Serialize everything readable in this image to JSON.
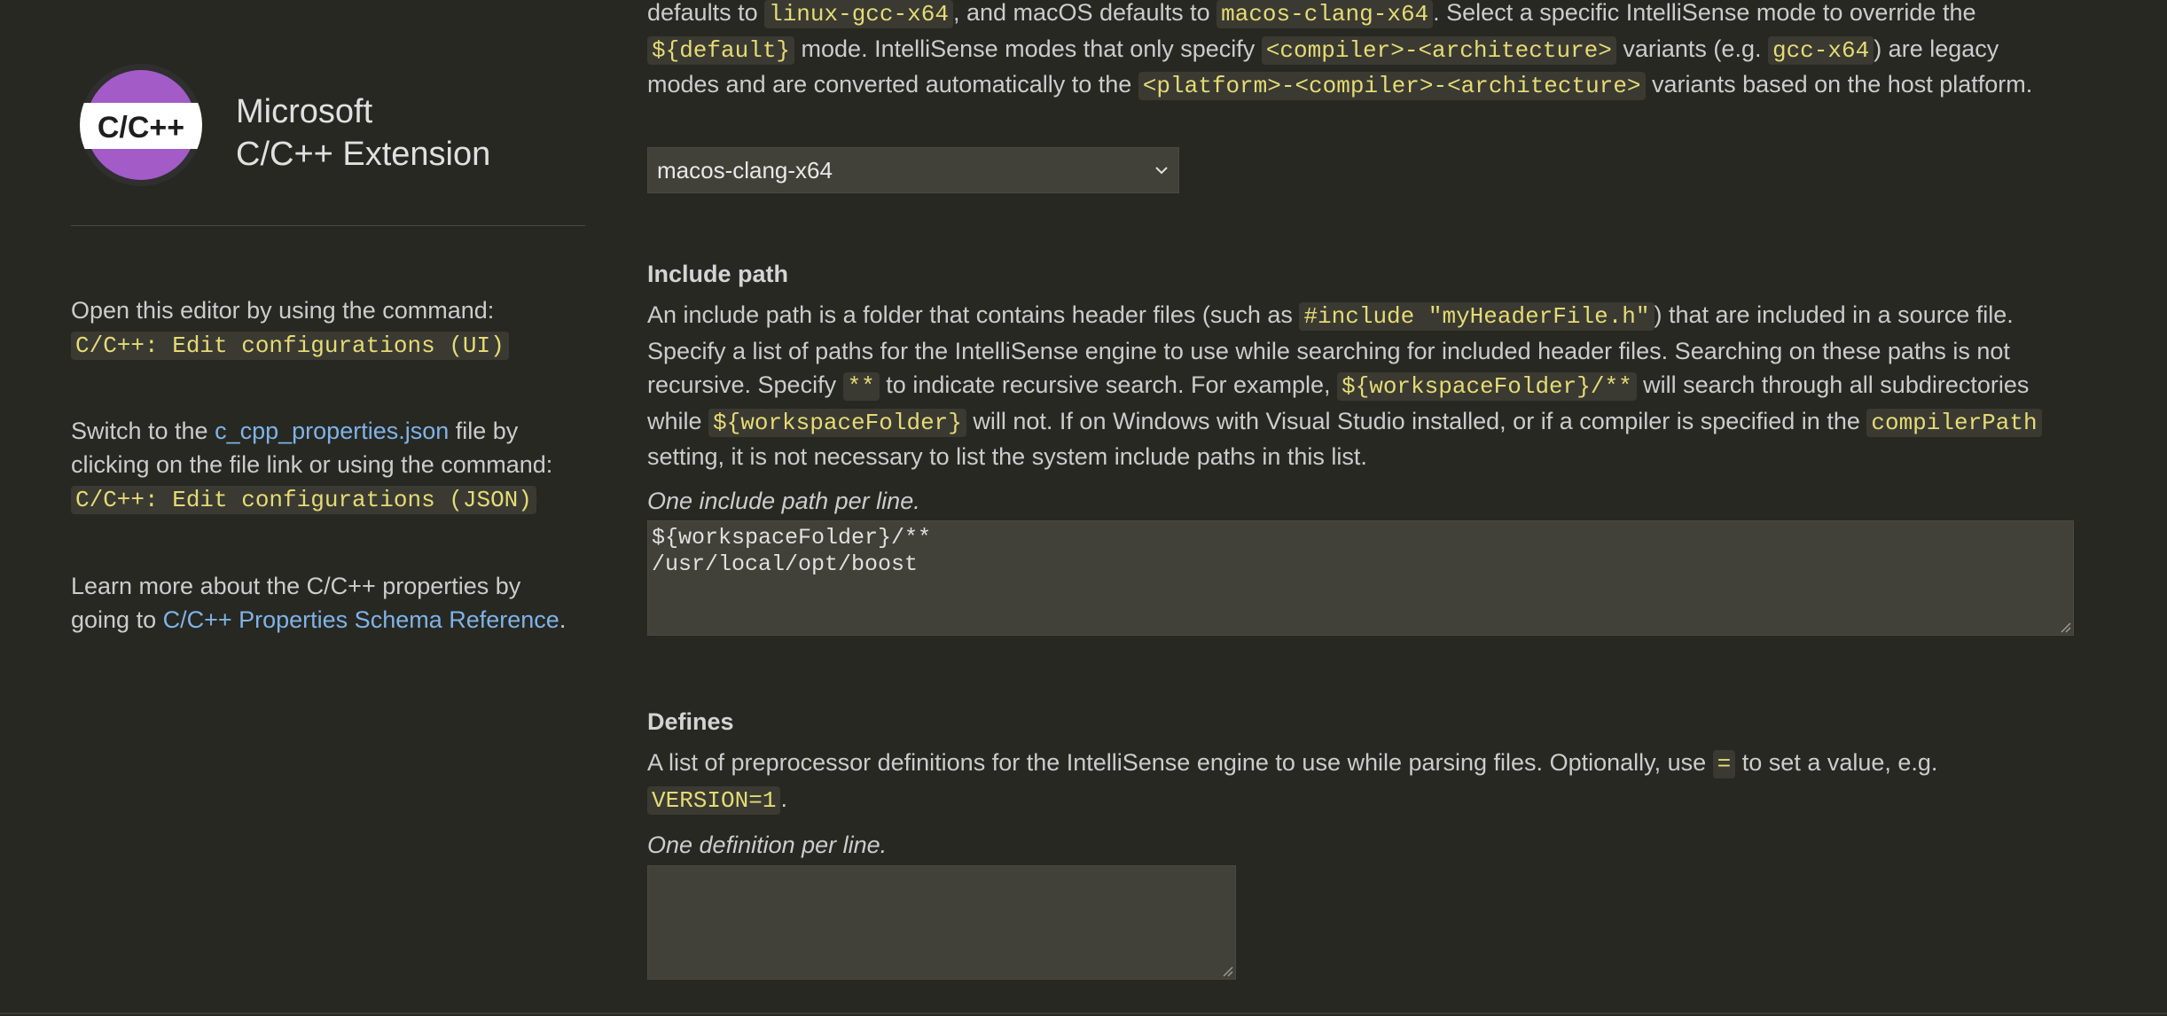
{
  "sidebar": {
    "brand_line1": "Microsoft",
    "brand_line2": "C/C++ Extension",
    "logo_text": "C/C++",
    "info1_text": "Open this editor by using the command:",
    "info1_command": "C/C++: Edit configurations (UI)",
    "info2_prefix": "Switch to the ",
    "info2_link": "c_cpp_properties.json",
    "info2_mid": " file by clicking on the file link or using the command:",
    "info2_command": "C/C++: Edit configurations (JSON)",
    "info3_prefix": "Learn more about the C/C++ properties by going to ",
    "info3_link": "C/C++ Properties Schema Reference",
    "info3_suffix": "."
  },
  "intellisense_mode": {
    "desc_p1": "defaults to ",
    "desc_c1": "linux-gcc-x64",
    "desc_p2": ", and macOS defaults to ",
    "desc_c2": "macos-clang-x64",
    "desc_p3": ". Select a specific IntelliSense mode to override the ",
    "desc_c3": "${default}",
    "desc_p4": " mode. IntelliSense modes that only specify ",
    "desc_c4": "<compiler>-<architecture>",
    "desc_p5": " variants (e.g. ",
    "desc_c5": "gcc-x64",
    "desc_p6": ") are legacy modes and are converted automatically to the ",
    "desc_c6": "<platform>-<compiler>-<architecture>",
    "desc_p7": " variants based on the host platform.",
    "selected": "macos-clang-x64"
  },
  "include_path": {
    "title": "Include path",
    "desc_p1": "An include path is a folder that contains header files (such as ",
    "desc_c1": "#include \"myHeaderFile.h\"",
    "desc_p2": ") that are included in a source file. Specify a list of paths for the IntelliSense engine to use while searching for included header files. Searching on these paths is not recursive. Specify ",
    "desc_c2": "**",
    "desc_p3": " to indicate recursive search. For example, ",
    "desc_c3": "${workspaceFolder}/**",
    "desc_p4": " will search through all subdirectories while ",
    "desc_c4": "${workspaceFolder}",
    "desc_p5": " will not. If on Windows with Visual Studio installed, or if a compiler is specified in the ",
    "desc_c5": "compilerPath",
    "desc_p6": " setting, it is not necessary to list the system include paths in this list.",
    "hint": "One include path per line.",
    "lines": [
      "${workspaceFolder}/**",
      "/usr/local/opt/boost"
    ]
  },
  "defines": {
    "title": "Defines",
    "desc_p1": "A list of preprocessor definitions for the IntelliSense engine to use while parsing files. Optionally, use ",
    "desc_c1": "=",
    "desc_p2": " to set a value, e.g. ",
    "desc_c2": "VERSION=1",
    "desc_p3": ".",
    "hint": "One definition per line.",
    "value": ""
  },
  "colors": {
    "background": "#272822",
    "code_text": "#e6db74",
    "link": "#7fb3e8",
    "logo_purple": "#a25bc7"
  }
}
